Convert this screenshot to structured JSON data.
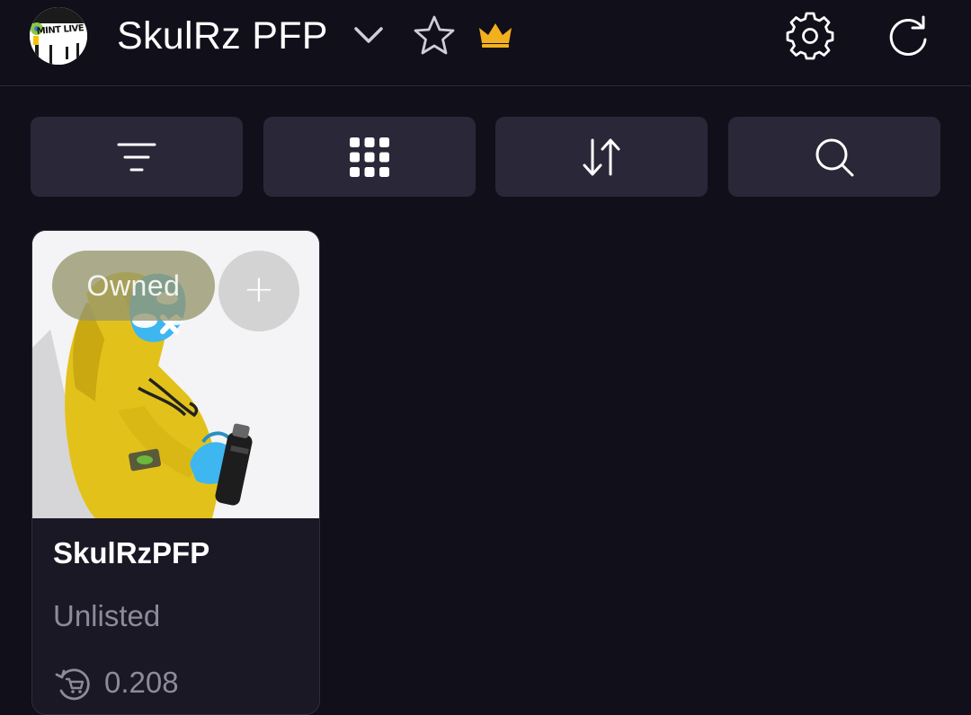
{
  "header": {
    "avatar_text": "MINT LIVE",
    "title": "SkulRz PFP",
    "icons": {
      "dropdown": "chevron-down-icon",
      "favorite": "star-icon",
      "premium": "crown-icon",
      "settings": "gear-icon",
      "refresh": "refresh-icon"
    },
    "crown_color": "#f2b01e"
  },
  "toolbar": {
    "buttons": [
      {
        "icon": "filter-icon"
      },
      {
        "icon": "grid-icon"
      },
      {
        "icon": "sort-icon"
      },
      {
        "icon": "search-icon"
      }
    ]
  },
  "card": {
    "badge": "Owned",
    "add_symbol": "+",
    "name": "SkulRzPFP",
    "status": "Unlisted",
    "price": "0.208",
    "price_icon": "cart-refresh-icon"
  },
  "colors": {
    "background": "#110f1a",
    "button_bg": "#2a2738",
    "card_bg": "#1a1824",
    "muted_text": "#8e8a9b",
    "hoodie": "#e2c21a",
    "skin": "#3eb6f0"
  }
}
